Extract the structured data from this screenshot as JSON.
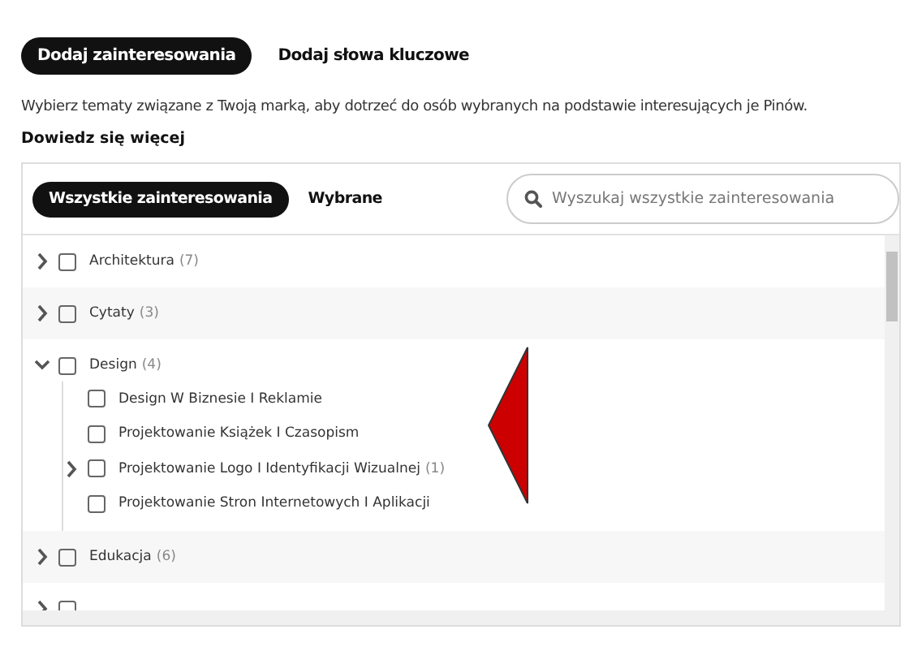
{
  "tabs": [
    {
      "label": "Dodaj zainteresowania",
      "selected": true
    },
    {
      "label": "Dodaj słowa kluczowe",
      "selected": false
    }
  ],
  "description": "Wybierz tematy związane z Twoją marką, aby dotrzeć do osób wybranych na podstawie interesujących je Pinów.",
  "learn_more_link": "Dowiedz się więcej",
  "panel": {
    "tabs": [
      {
        "label": "Wszystkie zainteresowania",
        "selected": true
      },
      {
        "label": "Wybrane",
        "selected": false
      }
    ],
    "search": {
      "placeholder": "Wyszukaj wszystkie zainteresowania"
    },
    "tree": [
      {
        "label": "Architektura",
        "count": "(7)",
        "checked": false,
        "expanded": false
      },
      {
        "label": "Cytaty",
        "count": "(3)",
        "checked": false,
        "expanded": false
      },
      {
        "label": "Design",
        "count": "(4)",
        "checked": false,
        "expanded": true,
        "children": [
          {
            "label": "Design W Biznesie I Reklamie",
            "checked": false
          },
          {
            "label": "Projektowanie Książek I Czasopism",
            "checked": false
          },
          {
            "label": "Projektowanie Logo I Identyfikacji Wizualnej",
            "count": "(1)",
            "checked": false,
            "expanded": false
          },
          {
            "label": "Projektowanie Stron Internetowych I Aplikacji",
            "checked": false
          }
        ]
      },
      {
        "label": "Edukacja",
        "count": "(6)",
        "checked": false,
        "expanded": false
      },
      {
        "checked": false,
        "expanded": false
      }
    ]
  },
  "annotation": {
    "kind": "triangle"
  }
}
